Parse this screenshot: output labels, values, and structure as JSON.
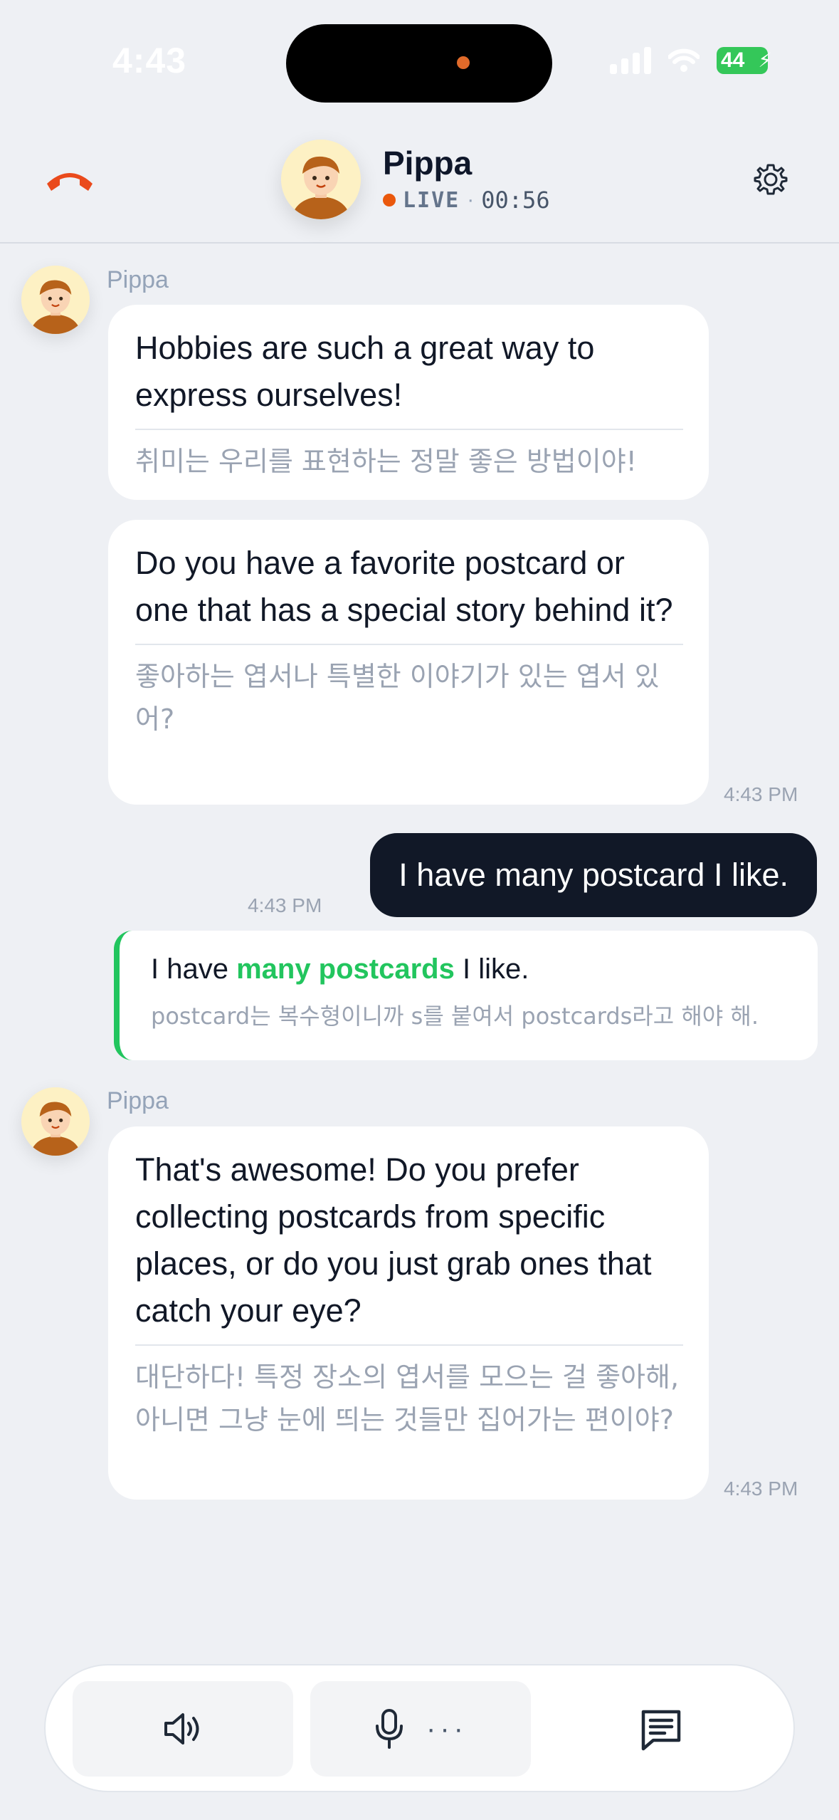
{
  "status_bar": {
    "time": "4:43",
    "battery": "44"
  },
  "header": {
    "name": "Pippa",
    "live_label": "LIVE",
    "separator": "·",
    "timer": "00:56"
  },
  "messages": [
    {
      "sender": "Pippa",
      "en": "Hobbies are such a great way to express ourselves!",
      "ko": "취미는 우리를 표현하는 정말 좋은 방법이야!"
    },
    {
      "en": "Do you have a favorite postcard or one that has a special story behind it?",
      "ko": "좋아하는 엽서나 특별한 이야기가 있는 엽서 있어?",
      "time": "4:43 PM"
    },
    {
      "user_text": "I have many postcard I like.",
      "time": "4:43 PM"
    },
    {
      "sender": "Pippa",
      "en": "That's awesome! Do you prefer collecting postcards from specific places, or do you just grab ones that catch your eye?",
      "ko": "대단하다! 특정 장소의 엽서를 모으는 걸 좋아해, 아니면 그냥 눈에 띄는 것들만 집어가는 편이야?",
      "time": "4:43 PM"
    }
  ],
  "correction": {
    "before": "I have ",
    "highlight": "many postcards",
    "after": " I like.",
    "note": "postcard는 복수형이니까 s를 붙여서 postcards라고 해야 해.",
    "highlight_color": "#22c55e"
  },
  "bottom_bar": {
    "mic_dots": "···"
  },
  "colors": {
    "accent_live": "#ea580c",
    "user_bubble": "#111827",
    "correction": "#22c55e"
  }
}
